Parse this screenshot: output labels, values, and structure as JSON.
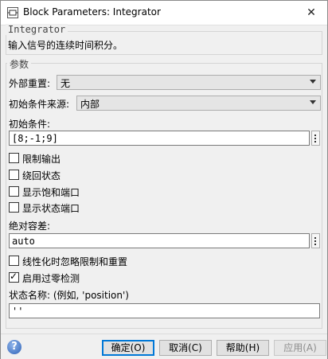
{
  "window": {
    "title": "Block Parameters: Integrator",
    "close_glyph": "✕"
  },
  "integrator_group": {
    "label": "Integrator",
    "description": "输入信号的连续时间积分。"
  },
  "params_group": {
    "label": "参数",
    "external_reset": {
      "label": "外部重置:",
      "value": "无"
    },
    "ic_source": {
      "label": "初始条件来源:",
      "value": "内部"
    },
    "initial_condition": {
      "label": "初始条件:",
      "value": "[8;-1;9]"
    },
    "checkboxes": {
      "limit_output": {
        "label": "限制输出",
        "checked": false
      },
      "wrap_state": {
        "label": "绕回状态",
        "checked": false
      },
      "show_saturation_port": {
        "label": "显示饱和端口",
        "checked": false
      },
      "show_state_port": {
        "label": "显示状态端口",
        "checked": false
      }
    },
    "abs_tolerance": {
      "label": "绝对容差:",
      "value": "auto"
    },
    "ignore_limit_reset": {
      "label": "线性化时忽略限制和重置",
      "checked": false
    },
    "zero_crossing": {
      "label": "启用过零检测",
      "checked": true
    },
    "state_name": {
      "label": "状态名称: (例如, 'position')",
      "value": "''"
    }
  },
  "buttons": {
    "ok": "确定(O)",
    "cancel": "取消(C)",
    "help": "帮助(H)",
    "apply": "应用(A)"
  },
  "colors": {
    "accent": "#0078d7",
    "help_icon": "#2f63b8"
  }
}
